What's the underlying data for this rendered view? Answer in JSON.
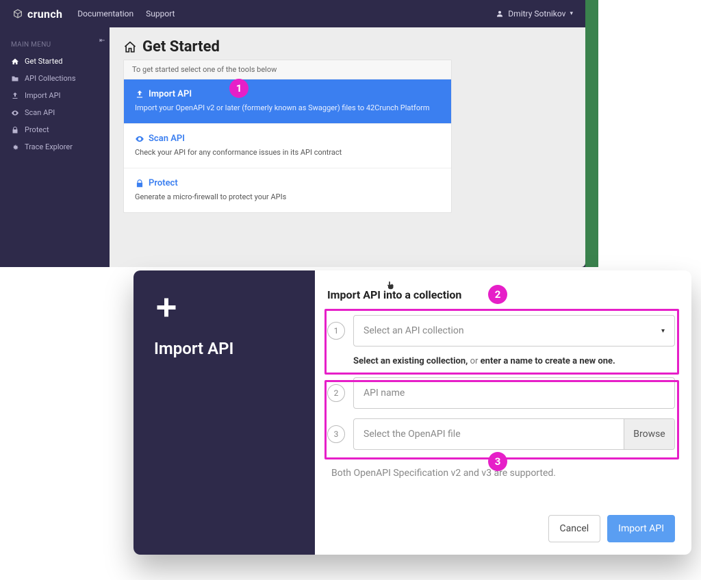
{
  "brand": "crunch",
  "topnav": {
    "documentation": "Documentation",
    "support": "Support"
  },
  "user": {
    "name": "Dmitry Sotnikov"
  },
  "sidebar": {
    "heading": "MAIN MENU",
    "items": [
      {
        "label": "Get Started",
        "icon": "home"
      },
      {
        "label": "API Collections",
        "icon": "folder"
      },
      {
        "label": "Import API",
        "icon": "import"
      },
      {
        "label": "Scan API",
        "icon": "eye"
      },
      {
        "label": "Protect",
        "icon": "lock"
      },
      {
        "label": "Trace Explorer",
        "icon": "gear"
      }
    ]
  },
  "page": {
    "title": "Get Started",
    "hint": "To get started select one of the tools below",
    "tools": [
      {
        "title": "Import API",
        "desc": "Import your OpenAPI v2 or later (formerly known as Swagger) files to 42Crunch Platform",
        "icon": "import"
      },
      {
        "title": "Scan API",
        "desc": "Check your API for any conformance issues in its API contract",
        "icon": "eye"
      },
      {
        "title": "Protect",
        "desc": "Generate a micro-firewall to protect your APIs",
        "icon": "lock"
      }
    ]
  },
  "modal": {
    "left_title": "Import API",
    "heading": "Import API into a collection",
    "step1_placeholder": "Select an API collection",
    "helper_bold_a": "Select an existing collection,",
    "helper_light": " or ",
    "helper_bold_b": "enter a name to create a new one.",
    "step2_placeholder": "API name",
    "step3_placeholder": "Select the OpenAPI file",
    "browse": "Browse",
    "note": "Both OpenAPI Specification v2 and v3 are supported.",
    "cancel": "Cancel",
    "submit": "Import API"
  },
  "badges": {
    "b1": "1",
    "b2": "2",
    "b3": "3"
  }
}
